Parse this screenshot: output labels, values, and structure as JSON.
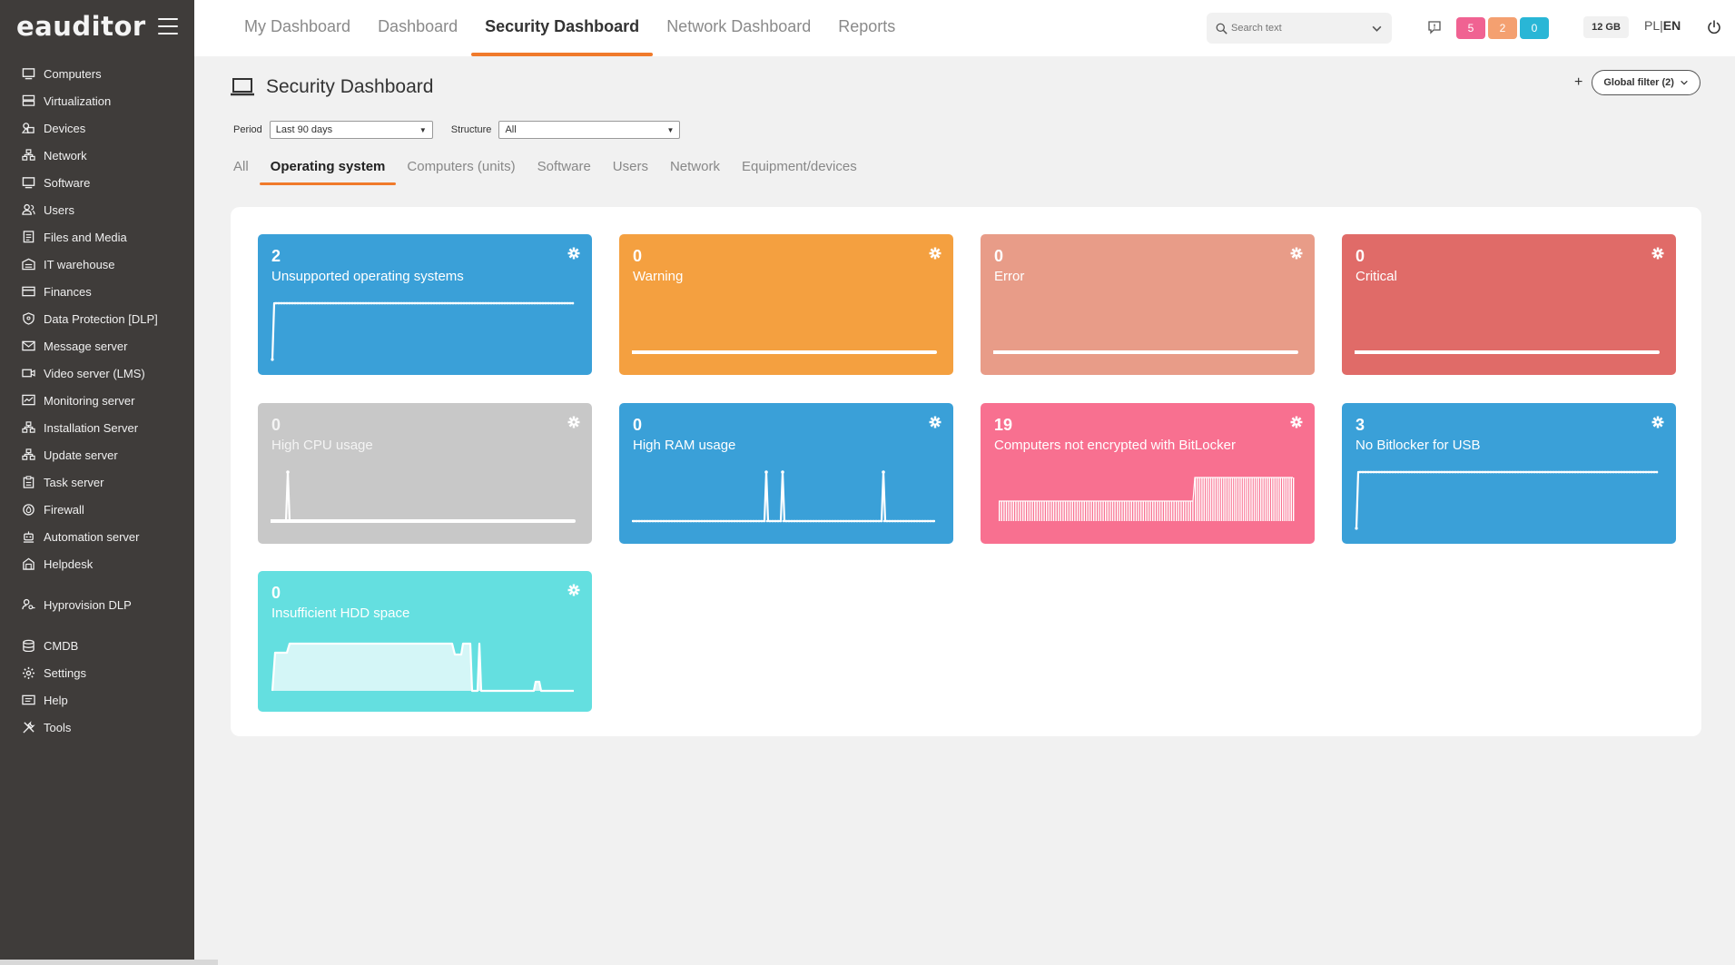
{
  "app": {
    "logo": "eauditor"
  },
  "sidebar": {
    "groups": [
      [
        {
          "label": "Computers",
          "icon": "monitor-icon"
        },
        {
          "label": "Virtualization",
          "icon": "server-icon"
        },
        {
          "label": "Devices",
          "icon": "devices-icon"
        },
        {
          "label": "Network",
          "icon": "network-icon"
        },
        {
          "label": "Software",
          "icon": "monitor-icon"
        },
        {
          "label": "Users",
          "icon": "users-icon"
        },
        {
          "label": "Files and Media",
          "icon": "files-icon"
        },
        {
          "label": "IT warehouse",
          "icon": "warehouse-icon"
        },
        {
          "label": "Finances",
          "icon": "card-icon"
        },
        {
          "label": "Data Protection [DLP]",
          "icon": "shield-icon"
        },
        {
          "label": "Message server",
          "icon": "mail-icon"
        },
        {
          "label": "Video server (LMS)",
          "icon": "video-icon"
        },
        {
          "label": "Monitoring server",
          "icon": "monitoring-icon"
        },
        {
          "label": "Installation Server",
          "icon": "network-icon"
        },
        {
          "label": "Update server",
          "icon": "network-icon"
        },
        {
          "label": "Task server",
          "icon": "clipboard-icon"
        },
        {
          "label": "Firewall",
          "icon": "firewall-icon"
        },
        {
          "label": "Automation server",
          "icon": "robot-icon"
        },
        {
          "label": "Helpdesk",
          "icon": "helpdesk-icon"
        }
      ],
      [
        {
          "label": "Hyprovision DLP",
          "icon": "user-key-icon"
        }
      ],
      [
        {
          "label": "CMDB",
          "icon": "database-icon"
        },
        {
          "label": "Settings",
          "icon": "gear-icon"
        },
        {
          "label": "Help",
          "icon": "help-icon"
        },
        {
          "label": "Tools",
          "icon": "tools-icon"
        }
      ]
    ]
  },
  "topnav": {
    "tabs": [
      "My Dashboard",
      "Dashboard",
      "Security Dashboard",
      "Network Dashboard",
      "Reports"
    ],
    "active": 2
  },
  "search": {
    "placeholder": "Search text"
  },
  "badges": [
    {
      "value": "5",
      "color": "#f06292"
    },
    {
      "value": "2",
      "color": "#f4a070"
    },
    {
      "value": "0",
      "color": "#29b6d6"
    }
  ],
  "memory": "12 GB",
  "lang": {
    "pl": "PL",
    "sep": "|",
    "en": "EN"
  },
  "page": {
    "title": "Security Dashboard"
  },
  "global_filter": {
    "plus": "+",
    "label": "Global filter (2)"
  },
  "filters": {
    "period_label": "Period",
    "period_value": "Last 90 days",
    "structure_label": "Structure",
    "structure_value": "All"
  },
  "subtabs": {
    "items": [
      "All",
      "Operating system",
      "Computers (units)",
      "Software",
      "Users",
      "Network",
      "Equipment/devices"
    ],
    "active": 1
  },
  "cards": [
    {
      "value": "2",
      "label": "Unsupported operating systems",
      "color": "#3aa0d8",
      "text_dim": false,
      "spark": "flatHigh"
    },
    {
      "value": "0",
      "label": "Warning",
      "color": "#f4a040",
      "text_dim": false,
      "spark": "flatLow"
    },
    {
      "value": "0",
      "label": "Error",
      "color": "#e89c88",
      "text_dim": false,
      "spark": "flatLow"
    },
    {
      "value": "0",
      "label": "Critical",
      "color": "#e06b68",
      "text_dim": false,
      "spark": "flatLow"
    },
    {
      "value": "0",
      "label": "High CPU usage",
      "color": "#c8c8c8",
      "text_dim": true,
      "spark": "cpu"
    },
    {
      "value": "0",
      "label": "High RAM usage",
      "color": "#3aa0d8",
      "text_dim": false,
      "spark": "ram"
    },
    {
      "value": "19",
      "label": "Computers not encrypted with BitLocker",
      "color": "#f87090",
      "text_dim": false,
      "spark": "bars"
    },
    {
      "value": "3",
      "label": "No Bitlocker for USB",
      "color": "#3aa0d8",
      "text_dim": false,
      "spark": "flatHigh"
    },
    {
      "value": "0",
      "label": "Insufficient HDD space",
      "color": "#64dfe0",
      "text_dim": false,
      "spark": "hdd"
    }
  ]
}
